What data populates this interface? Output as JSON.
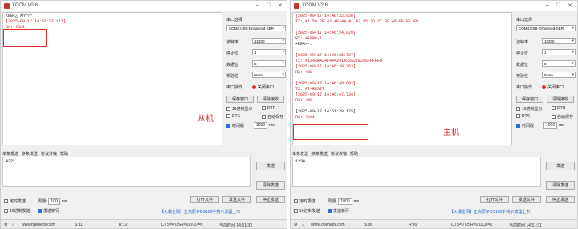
{
  "left": {
    "title": "XCOM V2.6",
    "log_lines": [
      {
        "text": "<EB<¿ Åñ???",
        "color": "black"
      },
      {
        "text": "[2025-09-17 14:51:27.111]",
        "color": "red"
      },
      {
        "text": "RX: 4321",
        "color": "red"
      }
    ],
    "side": {
      "port_label": "串口选择",
      "port_value": "COM5:USB-Enhanced-SER",
      "baud_label": "波特率",
      "baud_value": "19200",
      "stop_label": "停止位",
      "stop_value": "1",
      "data_label": "数据位",
      "data_value": "8",
      "parity_label": "校验位",
      "parity_value": "None",
      "op_label": "串口操作",
      "op_button": "关闭串口",
      "save_button": "保存窗口",
      "clear_button": "清除接收",
      "hex_display": "16进制显示",
      "dtr": "DTR",
      "rts": "RTS",
      "auto_save": "自动保存",
      "timestamp": "时间戳",
      "timestamp_ms": "1000",
      "ms": "ms"
    },
    "tabs": [
      "单条发送",
      "多条发送",
      "协议传输",
      "帮助"
    ],
    "send_text": "4321",
    "send_button": "发送",
    "clear_send_button": "清除发送",
    "timed_send": "定时发送",
    "period_label": "周期:",
    "period_value": "100",
    "period_unit": "ms",
    "hex_send": "16进制发送",
    "newline": "发送新行",
    "open_file": "打开文件",
    "send_file": "发送文件",
    "stop_send": "停止发送",
    "ad_text": "【火爆全网】正点原子DS100手持示波器上市",
    "status_url": "www.openedv.com",
    "status_s": "S:11",
    "status_r": "R:12",
    "status_lines": "CTS=0 DSR=0 DCD=0",
    "status_time": "当前时间 14:51:30",
    "label": "从机"
  },
  "right": {
    "title": "XCOM V2.6",
    "log_lines": [
      {
        "text": "[2025-09-17 14:46:32.956]",
        "color": "red"
      },
      {
        "text": "TX: 41 54 2B 42 4F 44 41 43 55 3D 27 30 46 FF FF FD",
        "color": "red"
      },
      {
        "text": "",
        "color": "red"
      },
      {
        "text": "[2025-09-17 14:46:34.029]",
        "color": "red"
      },
      {
        "text": "RX: +ERR=-1",
        "color": "red"
      },
      {
        "text": "+ERR=-1",
        "color": "black"
      },
      {
        "text": "",
        "color": "red"
      },
      {
        "text": "[2025-09-17 14:46:36.707]",
        "color": "red"
      },
      {
        "text": "TX: 41542B424F444241433527B245FFFFFD",
        "color": "red"
      },
      {
        "text": "[2025-09-17 14:46:39.763]",
        "color": "red"
      },
      {
        "text": "RX: +OK",
        "color": "red"
      },
      {
        "text": "",
        "color": "red"
      },
      {
        "text": "[2025-09-17 14:46:49.692]",
        "color": "red"
      },
      {
        "text": "TX: AT+RESET",
        "color": "red"
      },
      {
        "text": "[2025-09-17 14:46:47.734]",
        "color": "red"
      },
      {
        "text": "RX: +OK",
        "color": "red"
      },
      {
        "text": "",
        "color": "red"
      },
      {
        "text": "[2025-09-17 14:51:28.175]",
        "color": "black"
      },
      {
        "text": "RX: 4321",
        "color": "red"
      }
    ],
    "side": {
      "port_label": "串口选择",
      "port_value": "COM4:USB-Enhanced-SER",
      "baud_label": "波特率",
      "baud_value": "19200",
      "stop_label": "停止位",
      "stop_value": "1",
      "data_label": "数据位",
      "data_value": "8",
      "parity_label": "校验位",
      "parity_value": "None",
      "op_label": "串口操作",
      "op_button": "关闭串口",
      "save_button": "保存窗口",
      "clear_button": "清除接收",
      "hex_display": "16进制显示",
      "dtr": "DTR",
      "rts": "RTS",
      "auto_save": "自动保存",
      "timestamp": "时间戳",
      "timestamp_ms": "1000",
      "ms": "ms"
    },
    "tabs": [
      "单条发送",
      "多条发送",
      "协议传输",
      "帮助"
    ],
    "send_text": "1234",
    "send_button": "发送",
    "clear_send_button": "清除发送",
    "timed_send": "定时发送",
    "period_label": "周期:",
    "period_value": "1000",
    "period_unit": "ms",
    "hex_send": "16进制发送",
    "newline": "发送新行",
    "open_file": "打开文件",
    "send_file": "发送文件",
    "stop_send": "停止发送",
    "ad_text": "【火爆全网】正点原子DS100手持示波器上市",
    "status_url": "www.openedv.com",
    "status_s": "S:96",
    "status_r": "R:49",
    "status_lines": "CTS=0 DSR=0 DCD=0",
    "status_time": "当前时间 14:51:31",
    "label": "主机"
  }
}
